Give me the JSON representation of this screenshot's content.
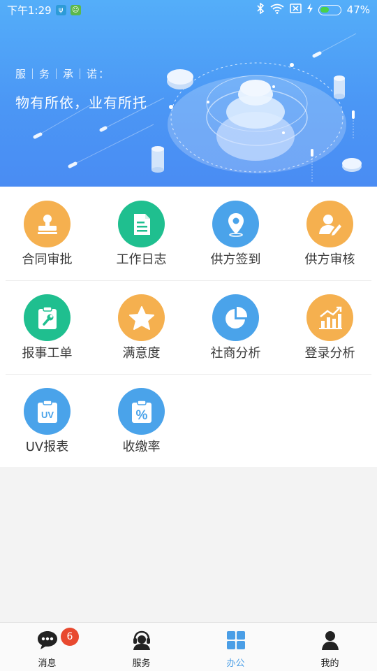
{
  "status_bar": {
    "time": "下午1:29",
    "battery_percent": "47%",
    "battery_level": 0.47
  },
  "banner": {
    "promise_title": "服｜务｜承｜诺：",
    "promise_slogan": "物有所依，业有所托"
  },
  "grid": {
    "items": [
      {
        "label": "合同审批",
        "icon": "stamp-icon",
        "color": "#f5b04f"
      },
      {
        "label": "工作日志",
        "icon": "document-icon",
        "color": "#1fbf8f"
      },
      {
        "label": "供方签到",
        "icon": "location-pin-icon",
        "color": "#4aa3ea"
      },
      {
        "label": "供方审核",
        "icon": "user-edit-icon",
        "color": "#f5b04f"
      },
      {
        "label": "报事工单",
        "icon": "wrench-clipboard-icon",
        "color": "#1fbf8f"
      },
      {
        "label": "满意度",
        "icon": "star-icon",
        "color": "#f5b04f"
      },
      {
        "label": "社商分析",
        "icon": "pie-chart-icon",
        "color": "#4aa3ea"
      },
      {
        "label": "登录分析",
        "icon": "bar-chart-icon",
        "color": "#f5b04f"
      },
      {
        "label": "UV报表",
        "icon": "uv-clipboard-icon",
        "color": "#4aa3ea"
      },
      {
        "label": "收缴率",
        "icon": "percent-clipboard-icon",
        "color": "#4aa3ea"
      }
    ],
    "uv_text": "UV",
    "percent_text": "%"
  },
  "tab_bar": {
    "tabs": [
      {
        "label": "消息",
        "icon": "chat-bubble-icon"
      },
      {
        "label": "服务",
        "icon": "headset-agent-icon"
      },
      {
        "label": "办公",
        "icon": "grid-apps-icon",
        "active": true
      },
      {
        "label": "我的",
        "icon": "person-icon"
      }
    ],
    "message_badge": "6",
    "active_color": "#4a9ee6"
  }
}
